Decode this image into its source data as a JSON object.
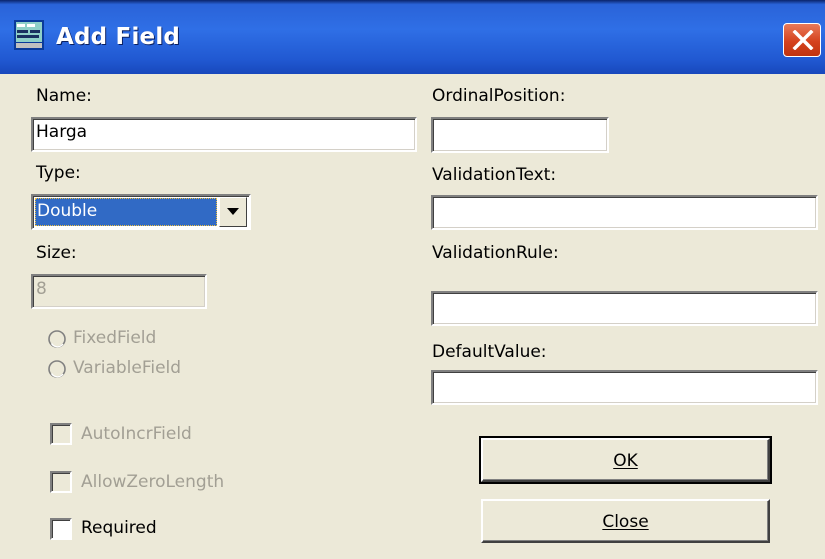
{
  "window": {
    "title": "Add Field",
    "app_icon": "database-app-icon",
    "close_icon": "close-icon"
  },
  "left": {
    "name_label": "Name:",
    "name_value": "Harga",
    "type_label": "Type:",
    "type_value": "Double",
    "size_label": "Size:",
    "size_value": "8",
    "fixed_field_label": "FixedField",
    "variable_field_label": "VariableField",
    "autoincr_label": "AutoIncrField",
    "allowzero_label": "AllowZeroLength",
    "required_label": "Required"
  },
  "right": {
    "ordinal_label": "OrdinalPosition:",
    "ordinal_value": "",
    "validation_text_label": "ValidationText:",
    "validation_text_value": "",
    "validation_rule_label": "ValidationRule:",
    "validation_rule_value": "",
    "default_value_label": "DefaultValue:",
    "default_value_value": ""
  },
  "buttons": {
    "ok_label": "OK",
    "close_label": "Close"
  },
  "colors": {
    "titlebar": "#2f6fe6",
    "selection": "#316ac5",
    "close_button": "#d5421e",
    "dialog_bg": "#ece9d8",
    "disabled_text": "#a29f94"
  }
}
